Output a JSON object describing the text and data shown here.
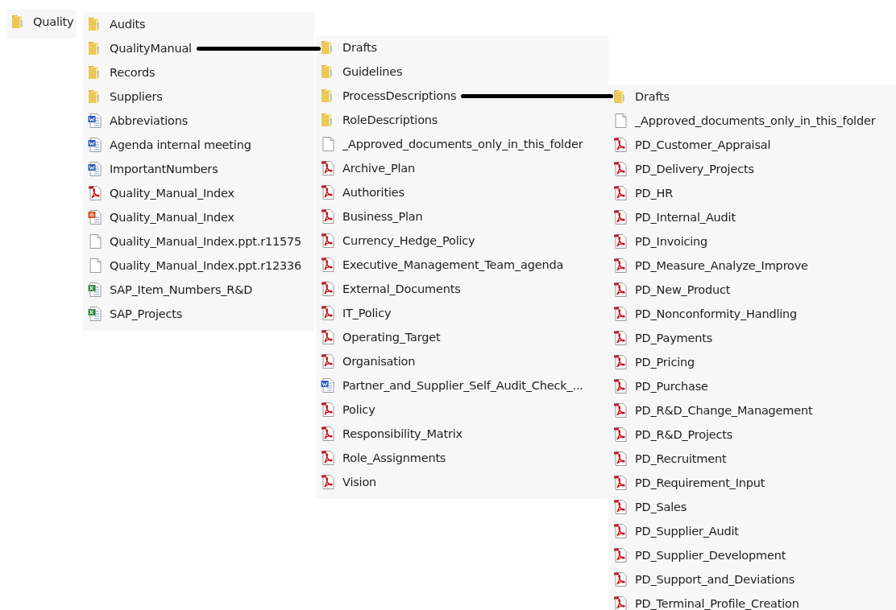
{
  "panels": [
    {
      "items": [
        {
          "kind": "folder",
          "name": "Quality",
          "expanded": false
        }
      ]
    },
    {
      "items": [
        {
          "kind": "folder",
          "name": "Audits",
          "expanded": false
        },
        {
          "kind": "folder",
          "name": "QualityManual",
          "expanded": true
        },
        {
          "kind": "folder",
          "name": "Records",
          "expanded": false
        },
        {
          "kind": "folder",
          "name": "Suppliers",
          "expanded": false
        },
        {
          "kind": "word",
          "name": "Abbreviations"
        },
        {
          "kind": "word",
          "name": "Agenda internal meeting"
        },
        {
          "kind": "word",
          "name": "ImportantNumbers"
        },
        {
          "kind": "pdf",
          "name": "Quality_Manual_Index"
        },
        {
          "kind": "ppt",
          "name": "Quality_Manual_Index"
        },
        {
          "kind": "blank",
          "name": "Quality_Manual_Index.ppt.r11575"
        },
        {
          "kind": "blank",
          "name": "Quality_Manual_Index.ppt.r12336"
        },
        {
          "kind": "excel",
          "name": "SAP_Item_Numbers_R&D"
        },
        {
          "kind": "excel",
          "name": "SAP_Projects"
        }
      ]
    },
    {
      "items": [
        {
          "kind": "folder",
          "name": "Drafts",
          "expanded": false
        },
        {
          "kind": "folder",
          "name": "Guidelines",
          "expanded": false
        },
        {
          "kind": "folder",
          "name": "ProcessDescriptions",
          "expanded": true
        },
        {
          "kind": "folder",
          "name": "RoleDescriptions",
          "expanded": false
        },
        {
          "kind": "blank",
          "name": "_Approved_documents_only_in_this_folder"
        },
        {
          "kind": "pdf",
          "name": "Archive_Plan"
        },
        {
          "kind": "pdf",
          "name": "Authorities"
        },
        {
          "kind": "pdf",
          "name": "Business_Plan"
        },
        {
          "kind": "pdf",
          "name": "Currency_Hedge_Policy"
        },
        {
          "kind": "pdf",
          "name": "Executive_Management_Team_agenda"
        },
        {
          "kind": "pdf",
          "name": "External_Documents"
        },
        {
          "kind": "pdf",
          "name": "IT_Policy"
        },
        {
          "kind": "pdf",
          "name": "Operating_Target"
        },
        {
          "kind": "pdf",
          "name": "Organisation"
        },
        {
          "kind": "word",
          "name": "Partner_and_Supplier_Self_Audit_Check_..."
        },
        {
          "kind": "pdf",
          "name": "Policy"
        },
        {
          "kind": "pdf",
          "name": "Responsibility_Matrix"
        },
        {
          "kind": "pdf",
          "name": "Role_Assignments"
        },
        {
          "kind": "pdf",
          "name": "Vision"
        }
      ]
    },
    {
      "items": [
        {
          "kind": "folder",
          "name": "Drafts",
          "expanded": false
        },
        {
          "kind": "blank",
          "name": "_Approved_documents_only_in_this_folder"
        },
        {
          "kind": "pdf",
          "name": "PD_Customer_Appraisal"
        },
        {
          "kind": "pdf",
          "name": "PD_Delivery_Projects"
        },
        {
          "kind": "pdf",
          "name": "PD_HR"
        },
        {
          "kind": "pdf",
          "name": "PD_Internal_Audit"
        },
        {
          "kind": "pdf",
          "name": "PD_Invoicing"
        },
        {
          "kind": "pdf",
          "name": "PD_Measure_Analyze_Improve"
        },
        {
          "kind": "pdf",
          "name": "PD_New_Product"
        },
        {
          "kind": "pdf",
          "name": "PD_Nonconformity_Handling"
        },
        {
          "kind": "pdf",
          "name": "PD_Payments"
        },
        {
          "kind": "pdf",
          "name": "PD_Pricing"
        },
        {
          "kind": "pdf",
          "name": "PD_Purchase"
        },
        {
          "kind": "pdf",
          "name": "PD_R&D_Change_Management"
        },
        {
          "kind": "pdf",
          "name": "PD_R&D_Projects"
        },
        {
          "kind": "pdf",
          "name": "PD_Recruitment"
        },
        {
          "kind": "pdf",
          "name": "PD_Requirement_Input"
        },
        {
          "kind": "pdf",
          "name": "PD_Sales"
        },
        {
          "kind": "pdf",
          "name": "PD_Supplier_Audit"
        },
        {
          "kind": "pdf",
          "name": "PD_Supplier_Development"
        },
        {
          "kind": "pdf",
          "name": "PD_Support_and_Deviations"
        },
        {
          "kind": "pdf",
          "name": "PD_Terminal_Profile_Creation"
        }
      ]
    }
  ]
}
